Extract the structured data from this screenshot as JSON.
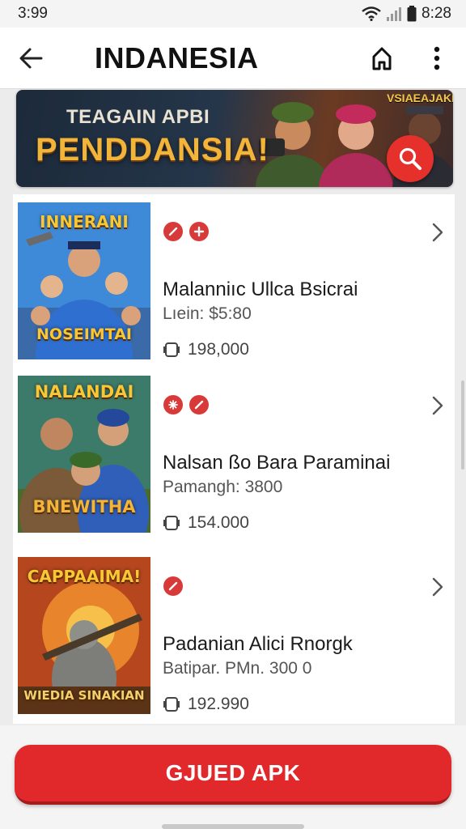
{
  "status_bar": {
    "time": "3:99",
    "clock_right": "8:28"
  },
  "app_bar": {
    "title": "INDANESIA"
  },
  "banner": {
    "line1": "TEAGAIN APBI",
    "line2": "PENDDANSIA!",
    "corner_tag": "VSIAEAJAKI"
  },
  "items": [
    {
      "name": "Malanniıc Ullca Bsicrai",
      "sub": "Lıein: $5:80",
      "downloads": "198,000",
      "cover_top": "INNERANI",
      "cover_bottom": "NOSEIMTAI"
    },
    {
      "name": "Nalsan ßo Bara Paraminai",
      "sub": "Pamangh: 3800",
      "downloads": "154.000",
      "cover_top": "NALANDAI",
      "cover_bottom": "BNEWITHA"
    },
    {
      "name": "Padanian Alici Rnorgk",
      "sub": "Batipar. PMn. 300 0",
      "downloads": "192.990",
      "cover_top": "CAPPAAIMA!",
      "cover_bottom": "WIEDIA SINAKIAN"
    }
  ],
  "cta": {
    "label": "GJUED APK"
  },
  "colors": {
    "accent": "#e1282a",
    "badge": "#d83a3a",
    "banner_text": "#f3b43a"
  },
  "icons": [
    "back-arrow-icon",
    "share-icon",
    "more-vert-icon",
    "search-icon",
    "wifi-icon",
    "signal-icon",
    "battery-icon",
    "chevron-right-icon",
    "download-icon"
  ]
}
